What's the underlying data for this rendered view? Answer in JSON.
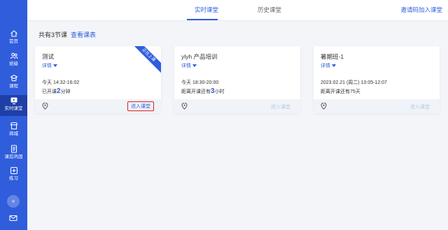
{
  "sidebar": {
    "items": [
      {
        "label": "首页",
        "icon": "home-icon"
      },
      {
        "label": "班级",
        "icon": "class-icon"
      },
      {
        "label": "课程",
        "icon": "course-icon"
      },
      {
        "label": "实时课堂",
        "icon": "live-class-icon",
        "active": true
      },
      {
        "label": "商城",
        "icon": "shop-icon"
      },
      {
        "label": "课后巩固",
        "icon": "review-icon"
      },
      {
        "label": "练习",
        "icon": "practice-icon"
      }
    ],
    "collapse_label": "«"
  },
  "header": {
    "tabs": [
      {
        "label": "实时课堂",
        "active": true
      },
      {
        "label": "历史课堂",
        "active": false
      }
    ],
    "invite_label": "邀请码加入课堂"
  },
  "main": {
    "title": "共有3节课",
    "view_schedule": "查看课表",
    "cards": [
      {
        "name": "测试",
        "detail": "详情",
        "time": "今天 14:32-16:02",
        "status_prefix": "已开课",
        "status_num": "2",
        "status_suffix": "分钟",
        "badge": "正在上课",
        "enter": "进入课堂",
        "enter_enabled": true
      },
      {
        "name": "ylyh 产品培训",
        "detail": "详情",
        "time": "今天 18:30-20:00",
        "status_prefix": "距离开课还有",
        "status_num": "3",
        "status_suffix": "小时",
        "enter": "进入课堂",
        "enter_enabled": false
      },
      {
        "name": "暑期班-1",
        "detail": "详情",
        "time": "2023.02.21 (周二) 10:05-12:07",
        "status_prefix": "距离开课还有75天",
        "status_num": "",
        "status_suffix": "",
        "enter": "进入课堂",
        "enter_enabled": false
      }
    ]
  },
  "colors": {
    "accent": "#2f5ddc",
    "sidebar": "#2f5ddc",
    "highlight": "#e02020"
  }
}
